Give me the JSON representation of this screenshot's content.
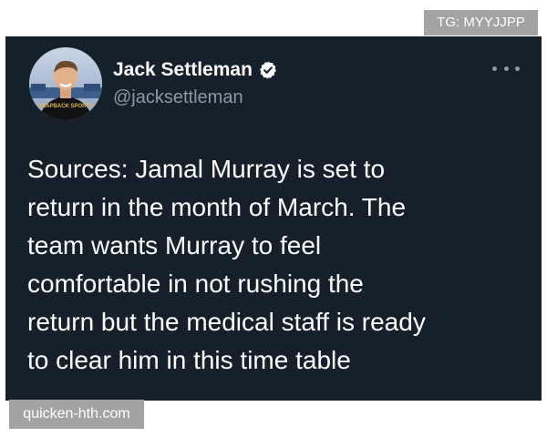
{
  "watermarks": {
    "top_right": "TG: MYYJJPP",
    "bottom_left": "quicken-hth.com"
  },
  "tweet": {
    "author_name": "Jack Settleman",
    "author_handle": "@jacksettleman",
    "verified": true,
    "avatar_jersey_text": "SNAPBACK SPORTS",
    "text": "Sources: Jamal Murray is set to\nreturn in the month of March. The\nteam wants Murray to feel\ncomfortable in not rushing the\nreturn but the medical staff is ready\nto clear him in this time table",
    "more_icon": "more-horizontal-icon"
  },
  "colors": {
    "card_background": "#15202b",
    "primary_text": "#ffffff",
    "secondary_text": "#8b98a5",
    "watermark_background": "#a3a3a3"
  }
}
